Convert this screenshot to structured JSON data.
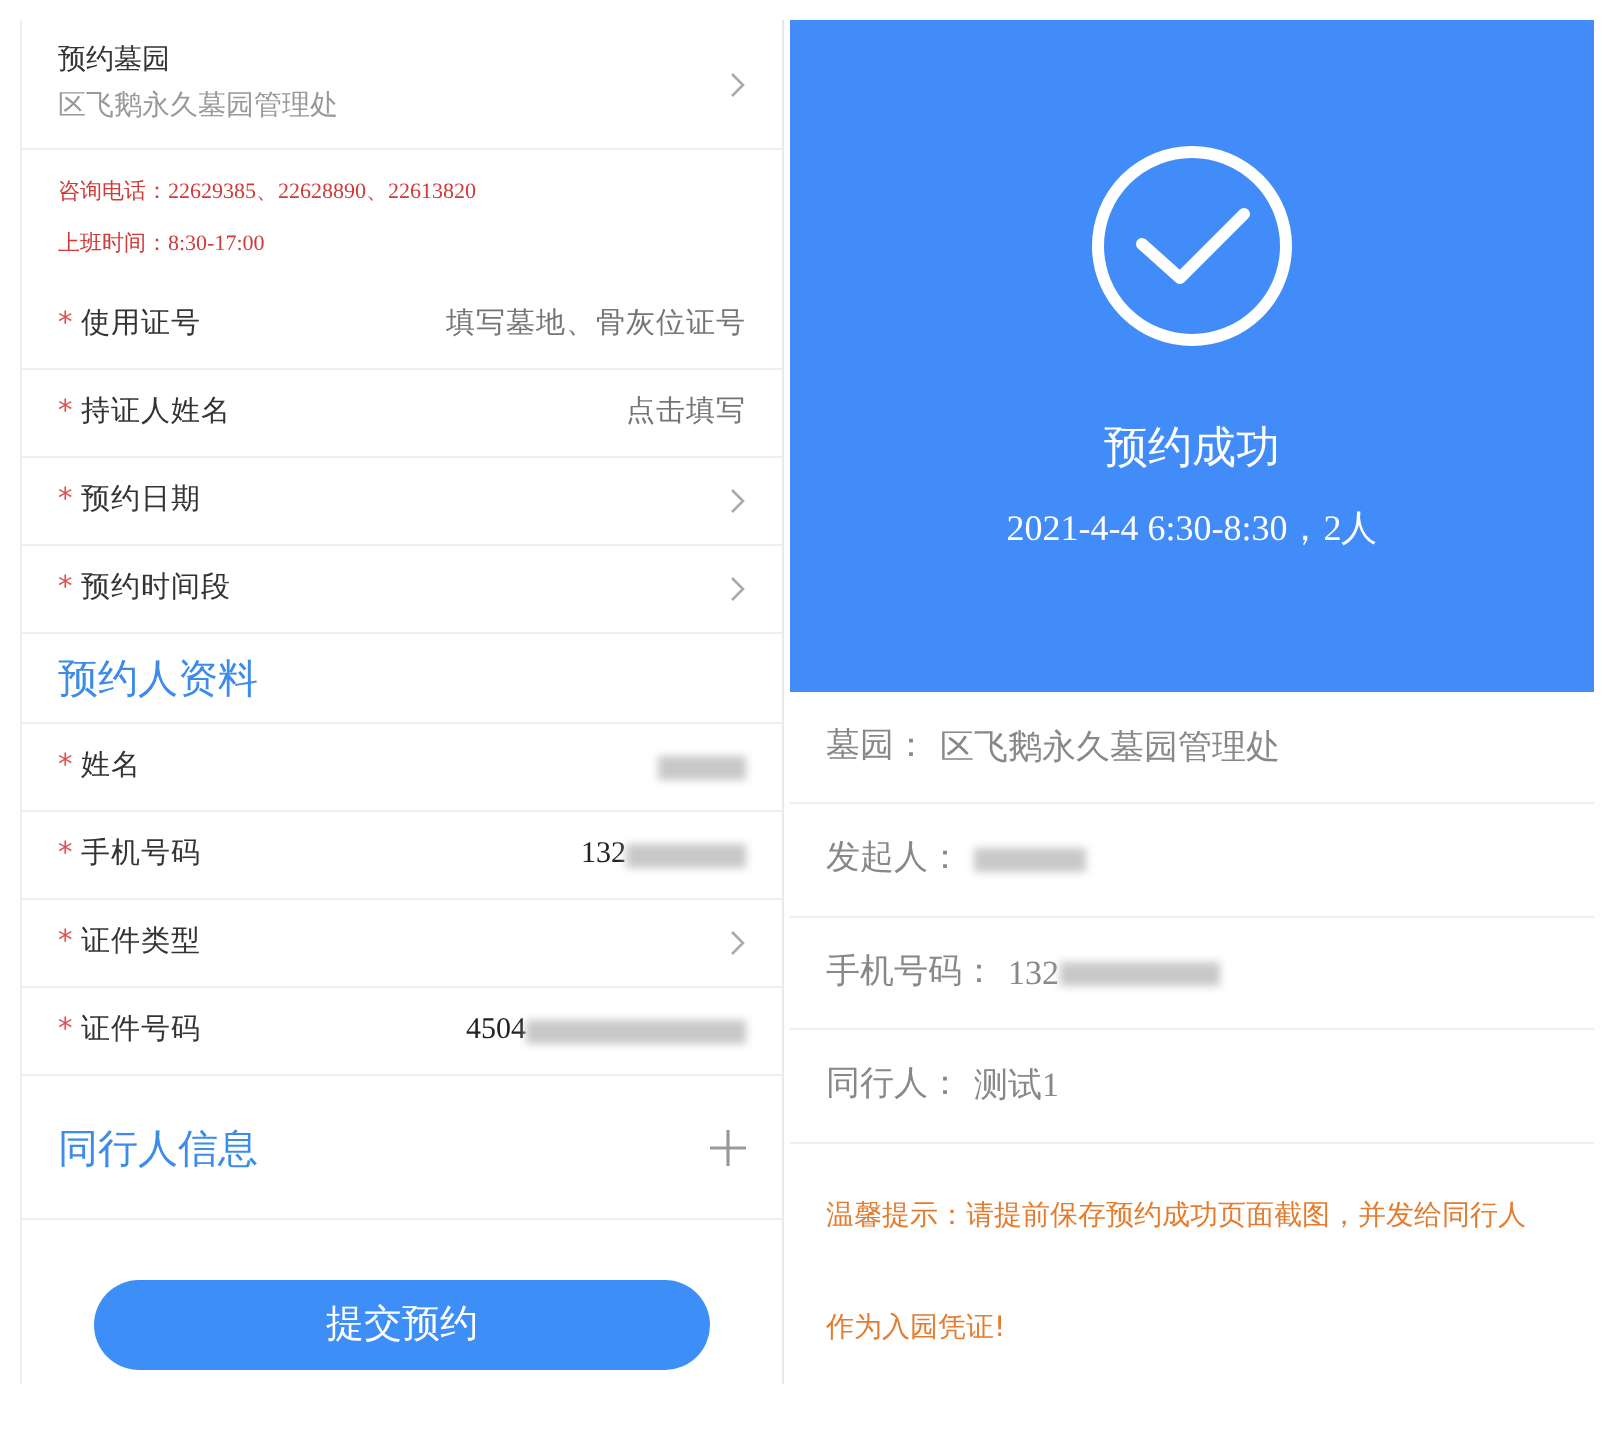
{
  "form": {
    "cemetery": {
      "label": "预约墓园",
      "value": "区飞鹅永久墓园管理处"
    },
    "notices": [
      "咨询电话：22629385、22628890、22613820",
      "上班时间：8:30-17:00"
    ],
    "fields": [
      {
        "kind": "input",
        "mark": "*",
        "label": "使用证号",
        "placeholder": "填写墓地、骨灰位证号"
      },
      {
        "kind": "input",
        "mark": "*",
        "label": "持证人姓名",
        "placeholder": "点击填写"
      },
      {
        "kind": "select",
        "mark": "*",
        "label": "预约日期"
      },
      {
        "kind": "select",
        "mark": "*",
        "label": "预约时间段"
      }
    ],
    "applicant_section": {
      "title": "预约人资料",
      "fields": [
        {
          "kind": "value",
          "mark": "*",
          "label": "姓名",
          "blurred": true
        },
        {
          "kind": "value",
          "mark": "*",
          "label": "手机号码",
          "value": "132",
          "blurred": true
        },
        {
          "kind": "select",
          "mark": "*",
          "label": "证件类型"
        },
        {
          "kind": "value",
          "mark": "*",
          "label": "证件号码",
          "value": "4504",
          "blurred": true
        }
      ]
    },
    "companion_section": {
      "title": "同行人信息"
    },
    "submit_button": "提交预约"
  },
  "result": {
    "title": "预约成功",
    "summary": "2021-4-4 6:30-8:30，2人",
    "details": [
      {
        "label": "墓园：",
        "value": "区飞鹅永久墓园管理处"
      },
      {
        "label": "发起人：",
        "blurred": true
      },
      {
        "label": "手机号码：",
        "value": "132",
        "blurred": true
      },
      {
        "label": "同行人：",
        "value": "测试1"
      }
    ],
    "tip": "温馨提示：请提前保存预约成功页面截图，并发给同行人作为入园凭证!"
  }
}
